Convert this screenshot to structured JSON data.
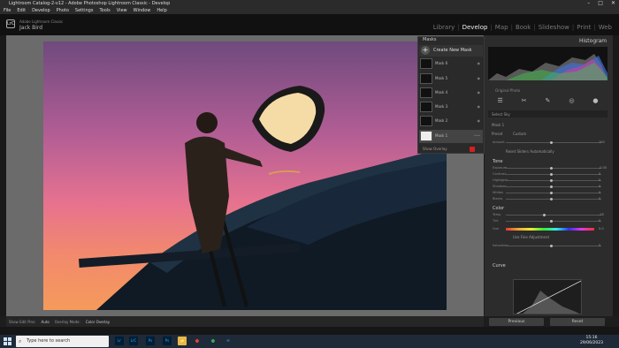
{
  "window": {
    "title": "Lightroom Catalog-2-v12 - Adobe Photoshop Lightroom Classic - Develop",
    "controls": [
      "–",
      "□",
      "✕"
    ]
  },
  "menu": [
    "File",
    "Edit",
    "Develop",
    "Photo",
    "Settings",
    "Tools",
    "View",
    "Window",
    "Help"
  ],
  "identity": {
    "badge": "LrC",
    "catalog": "Adobe Lightroom Classic",
    "user": "Jack Bird"
  },
  "modules": {
    "items": [
      "Library",
      "Develop",
      "Map",
      "Book",
      "Slideshow",
      "Print",
      "Web"
    ],
    "active": "Develop"
  },
  "masks_panel": {
    "title": "Masks",
    "create_label": "Create New Mask",
    "masks": [
      "Mask 6",
      "Mask 5",
      "Mask 4",
      "Mask 3",
      "Mask 2",
      "Mask 1"
    ],
    "selected": "Mask 1",
    "show_overlay": "Show Overlay"
  },
  "right_panel": {
    "histogram_title": "Histogram",
    "original_photo": "Original Photo",
    "tools": [
      "☰",
      "✂",
      "✎",
      "◎",
      "●"
    ],
    "select_label": "Select Sky",
    "mask_label": "Mask 1",
    "preset_label": "Preset",
    "preset_value": "Custom",
    "amount_label": "Amount",
    "amount_value": "100",
    "reset_label": "Reset Sliders Automatically",
    "tone_title": "Tone",
    "tone_sliders": [
      {
        "name": "Exposure",
        "value": "-0.00"
      },
      {
        "name": "Contrast",
        "value": "0"
      },
      {
        "name": "Highlights",
        "value": "0"
      },
      {
        "name": "Shadows",
        "value": "0"
      },
      {
        "name": "Whites",
        "value": "0"
      },
      {
        "name": "Blacks",
        "value": "0"
      }
    ],
    "color_title": "Color",
    "color_sliders": [
      {
        "name": "Temp",
        "value": "-18"
      },
      {
        "name": "Tint",
        "value": "0"
      },
      {
        "name": "Hue",
        "value": "0.0"
      }
    ],
    "fine_adjust_label": "Use Fine Adjustment",
    "saturation": {
      "name": "Saturation",
      "value": "0"
    },
    "curve_title": "Curve",
    "prev_button": "Previous",
    "reset_button": "Reset"
  },
  "toolbar": {
    "show_edit_pins": "Show Edit Pins:",
    "edit_pins_value": "Auto",
    "overlay_mode": "Overlay Mode:",
    "overlay_value": "Color Overlay"
  },
  "taskbar": {
    "search_placeholder": "Type here to search",
    "apps": [
      "Lr",
      "LrC",
      "Ps",
      "Ps",
      "📁",
      "⬤",
      "⬤",
      "✉"
    ],
    "time": "15:16",
    "date": "29/06/2023"
  },
  "colors": {
    "accent": "#d62020",
    "sky_top": "#6f4a7e",
    "sky_bottom": "#f59a5b"
  }
}
